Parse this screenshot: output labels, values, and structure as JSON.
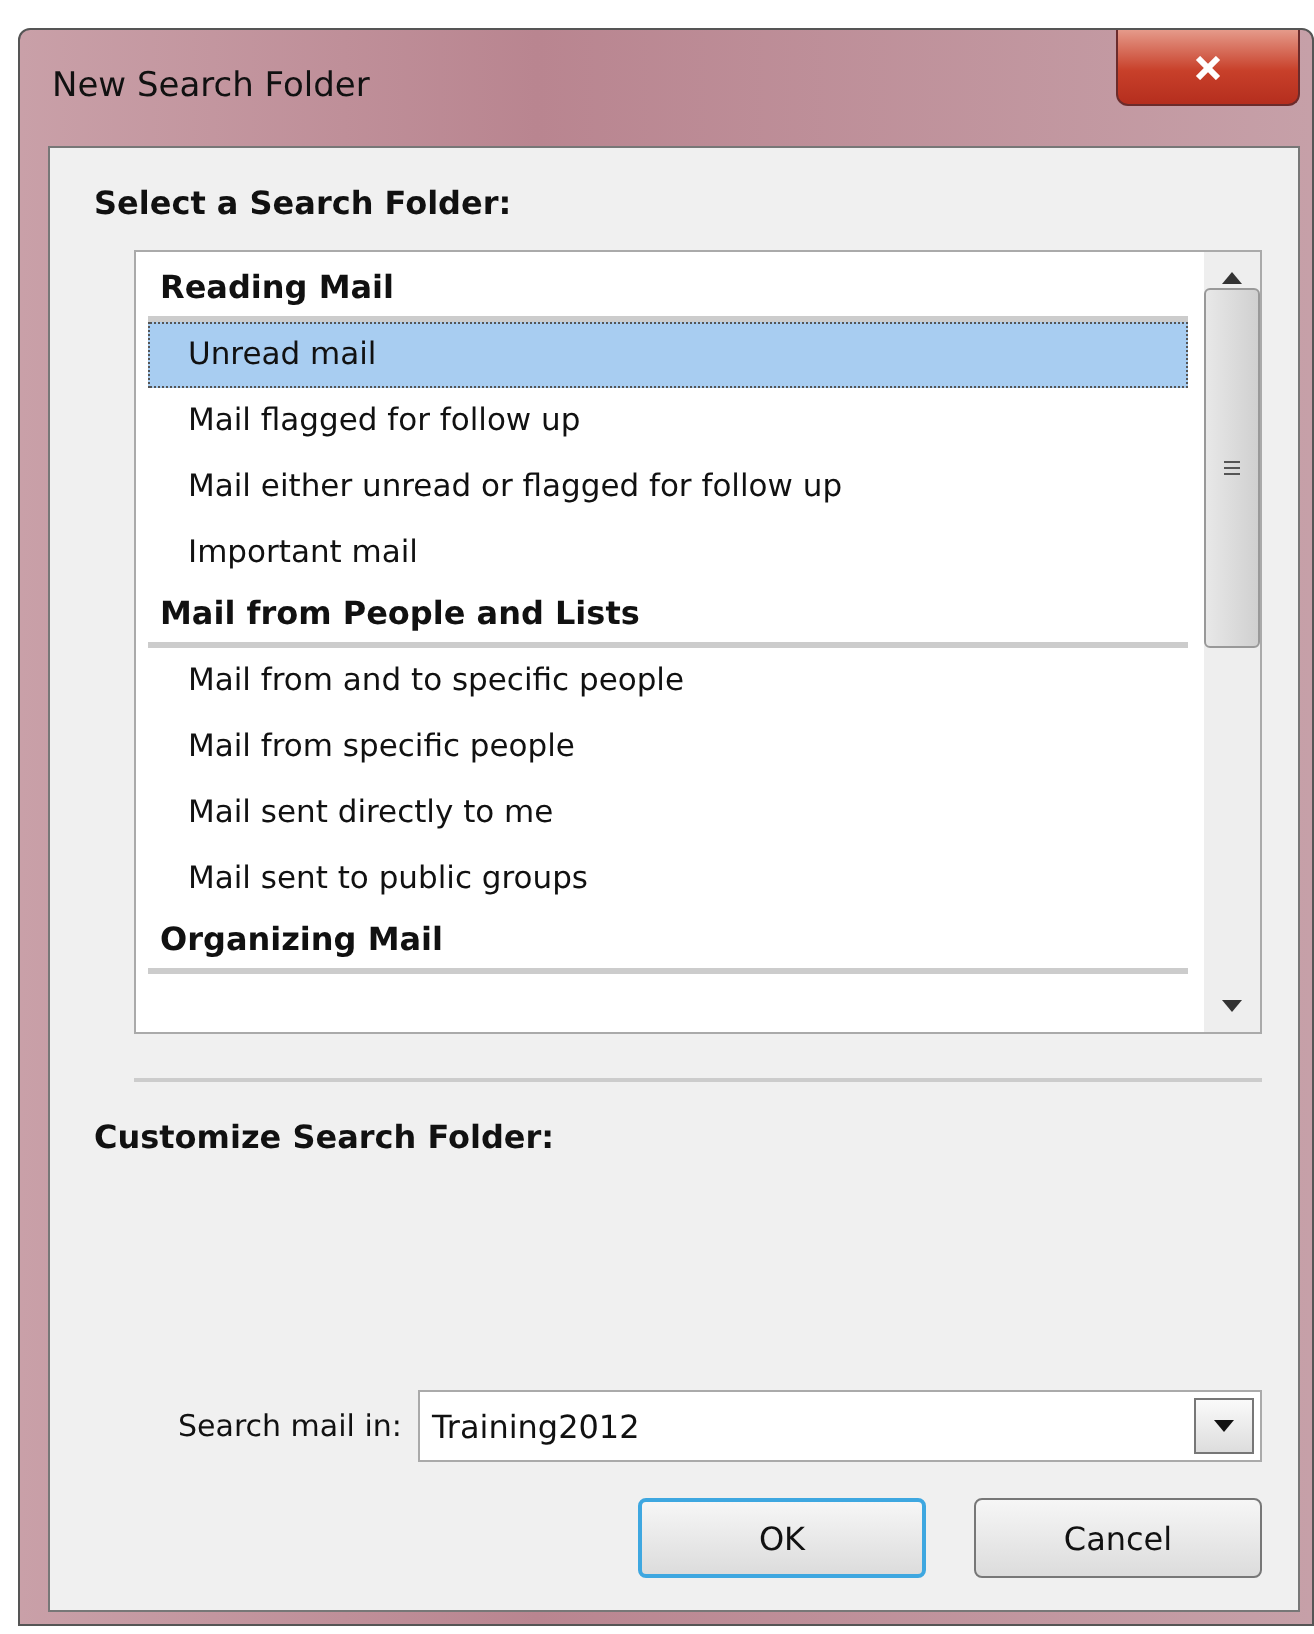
{
  "window": {
    "title": "New Search Folder"
  },
  "select_heading": "Select a Search Folder:",
  "folder_list": [
    {
      "kind": "header",
      "label": "Reading Mail"
    },
    {
      "kind": "item",
      "label": "Unread mail",
      "selected": true
    },
    {
      "kind": "item",
      "label": "Mail flagged for follow up",
      "selected": false
    },
    {
      "kind": "item",
      "label": "Mail either unread or flagged for follow up",
      "selected": false
    },
    {
      "kind": "item",
      "label": "Important mail",
      "selected": false
    },
    {
      "kind": "header",
      "label": "Mail from People and Lists"
    },
    {
      "kind": "item",
      "label": "Mail from and to specific people",
      "selected": false
    },
    {
      "kind": "item",
      "label": "Mail from specific people",
      "selected": false
    },
    {
      "kind": "item",
      "label": "Mail sent directly to me",
      "selected": false
    },
    {
      "kind": "item",
      "label": "Mail sent to public groups",
      "selected": false
    },
    {
      "kind": "header",
      "label": "Organizing Mail"
    }
  ],
  "customize_heading": "Customize Search Folder:",
  "search_in": {
    "label": "Search mail in:",
    "value": "Training2012"
  },
  "buttons": [
    {
      "label": "OK",
      "default": true
    },
    {
      "label": "Cancel",
      "default": false
    }
  ]
}
